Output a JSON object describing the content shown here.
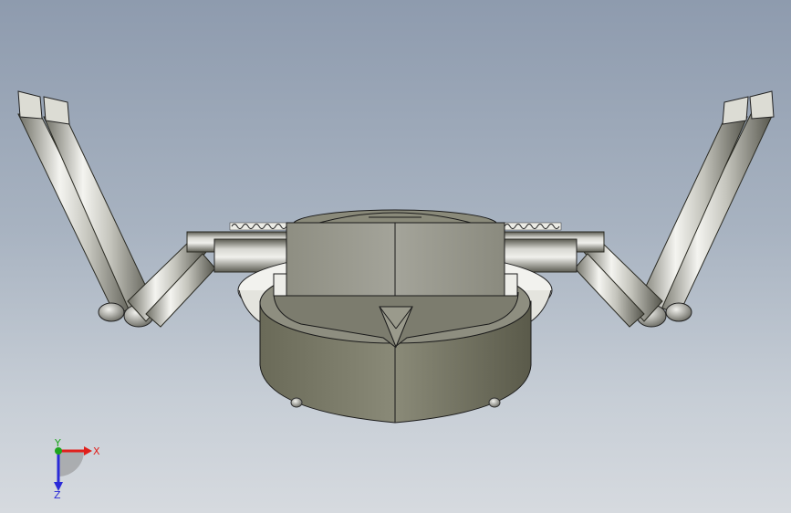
{
  "viewport": {
    "background_top": "#8e9bae",
    "background_bottom": "#d6dadf"
  },
  "model": {
    "body_color": "#8a8a7c",
    "pipe_color": "#c8c8c2",
    "edge_color": "#1a1a1a"
  },
  "triad": {
    "x_label": "X",
    "y_label": "Y",
    "z_label": "Z",
    "x_color": "#e0201c",
    "y_color": "#1ea51e",
    "z_color": "#2a2ad8"
  }
}
